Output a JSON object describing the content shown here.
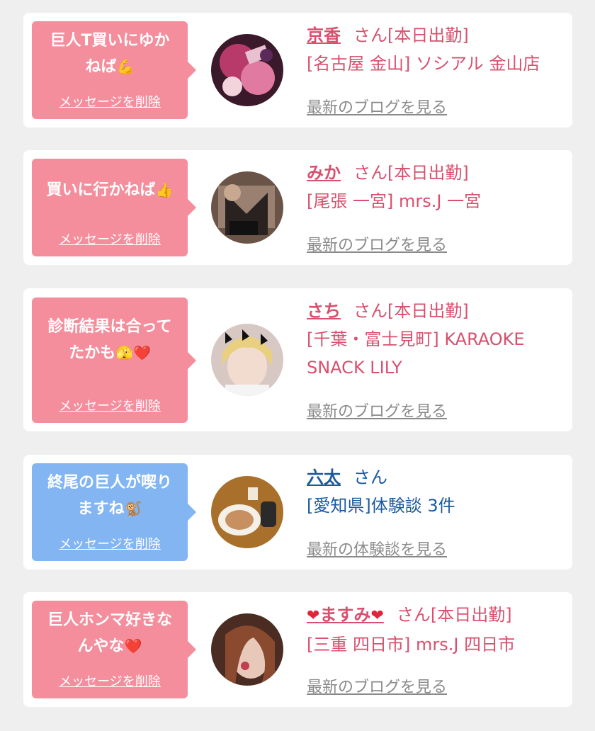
{
  "delete_label": "メッセージを削除",
  "colors": {
    "pink_bubble": "#f48e9d",
    "blue_bubble": "#82b5f1",
    "cast_text": "#d8506e",
    "user_text": "#1a5a9e",
    "link_gray": "#8a8a8a"
  },
  "items": [
    {
      "message": "巨人T買いにゆか\nねば",
      "emoji": "💪",
      "name": "京香",
      "suffix": "さん[本日出勤]",
      "shop": "[名古屋 金山] ソシアル 金山店",
      "link": "最新のブログを見る"
    },
    {
      "message": "買いに行かねば",
      "emoji": "👍",
      "name": "みか",
      "suffix": "さん[本日出勤]",
      "shop": "[尾張 一宮] mrs.J 一宮",
      "link": "最新のブログを見る"
    },
    {
      "message": "診断結果は合って\nたかも",
      "emoji": "🫣❤️",
      "name": "さち",
      "suffix": "さん[本日出勤]",
      "shop": "[千葉・富士見町] KARAOKE SNACK LILY",
      "link": "最新のブログを見る"
    },
    {
      "message": "終尾の巨人が喫り\nますね",
      "emoji": "🐒",
      "name": "六太",
      "suffix": "さん",
      "shop": "[愛知県]体験談 3件",
      "link": "最新の体験談を見る"
    },
    {
      "message": "巨人ホンマ好きな\nんやな",
      "emoji": "❤️",
      "name": "ますみ",
      "name_decor": "❤",
      "suffix": "さん[本日出勤]",
      "shop": "[三重 四日市] mrs.J 四日市",
      "link": "最新のブログを見る"
    }
  ]
}
